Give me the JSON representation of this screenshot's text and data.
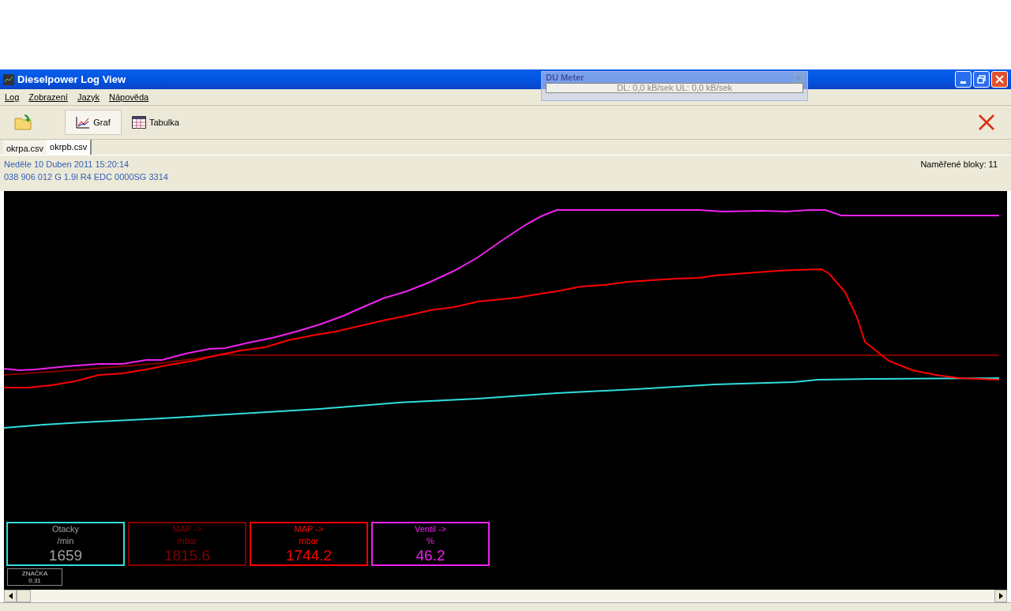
{
  "window": {
    "title": "Dieselpower Log View"
  },
  "menu": [
    "Log",
    "Zobrazení",
    "Jazyk",
    "Nápověda"
  ],
  "toolbar": [
    {
      "kind": "open"
    },
    {
      "kind": "graph",
      "label": "Graf",
      "selected": true
    },
    {
      "kind": "table",
      "label": "Tabulka",
      "selected": false
    }
  ],
  "tabs": [
    {
      "label": "okrpa.csv",
      "selected": false
    },
    {
      "label": "okrpb.csv",
      "selected": true
    }
  ],
  "info": {
    "date": "Neděle 10 Duben 2011 15:20:14",
    "ecu": "038 906 012 G  1.9l R4 EDC 0000SG  3314",
    "blocks": "Naměřené bloky: 11"
  },
  "channels": [
    {
      "name": "Otacky",
      "unit": "/min",
      "value": "1659",
      "color": "#33dddd",
      "grey_text": true
    },
    {
      "name": "MAP ->",
      "unit": "mbar",
      "value": "1815.6",
      "color": "#800000",
      "grey_text": false
    },
    {
      "name": "MAP ->",
      "unit": "mbar",
      "value": "1744.2",
      "color": "#ff0000",
      "grey_text": false
    },
    {
      "name": "Ventil ->",
      "unit": "%",
      "value": "46.2",
      "color": "#ee22ee",
      "grey_text": false
    }
  ],
  "marker": {
    "label": "ZNAČKA",
    "value": "0.31"
  },
  "du_meter": {
    "title": "DU Meter",
    "text": "DL: 0,0 kB/sek  UL: 0,0 kB/sek"
  }
}
